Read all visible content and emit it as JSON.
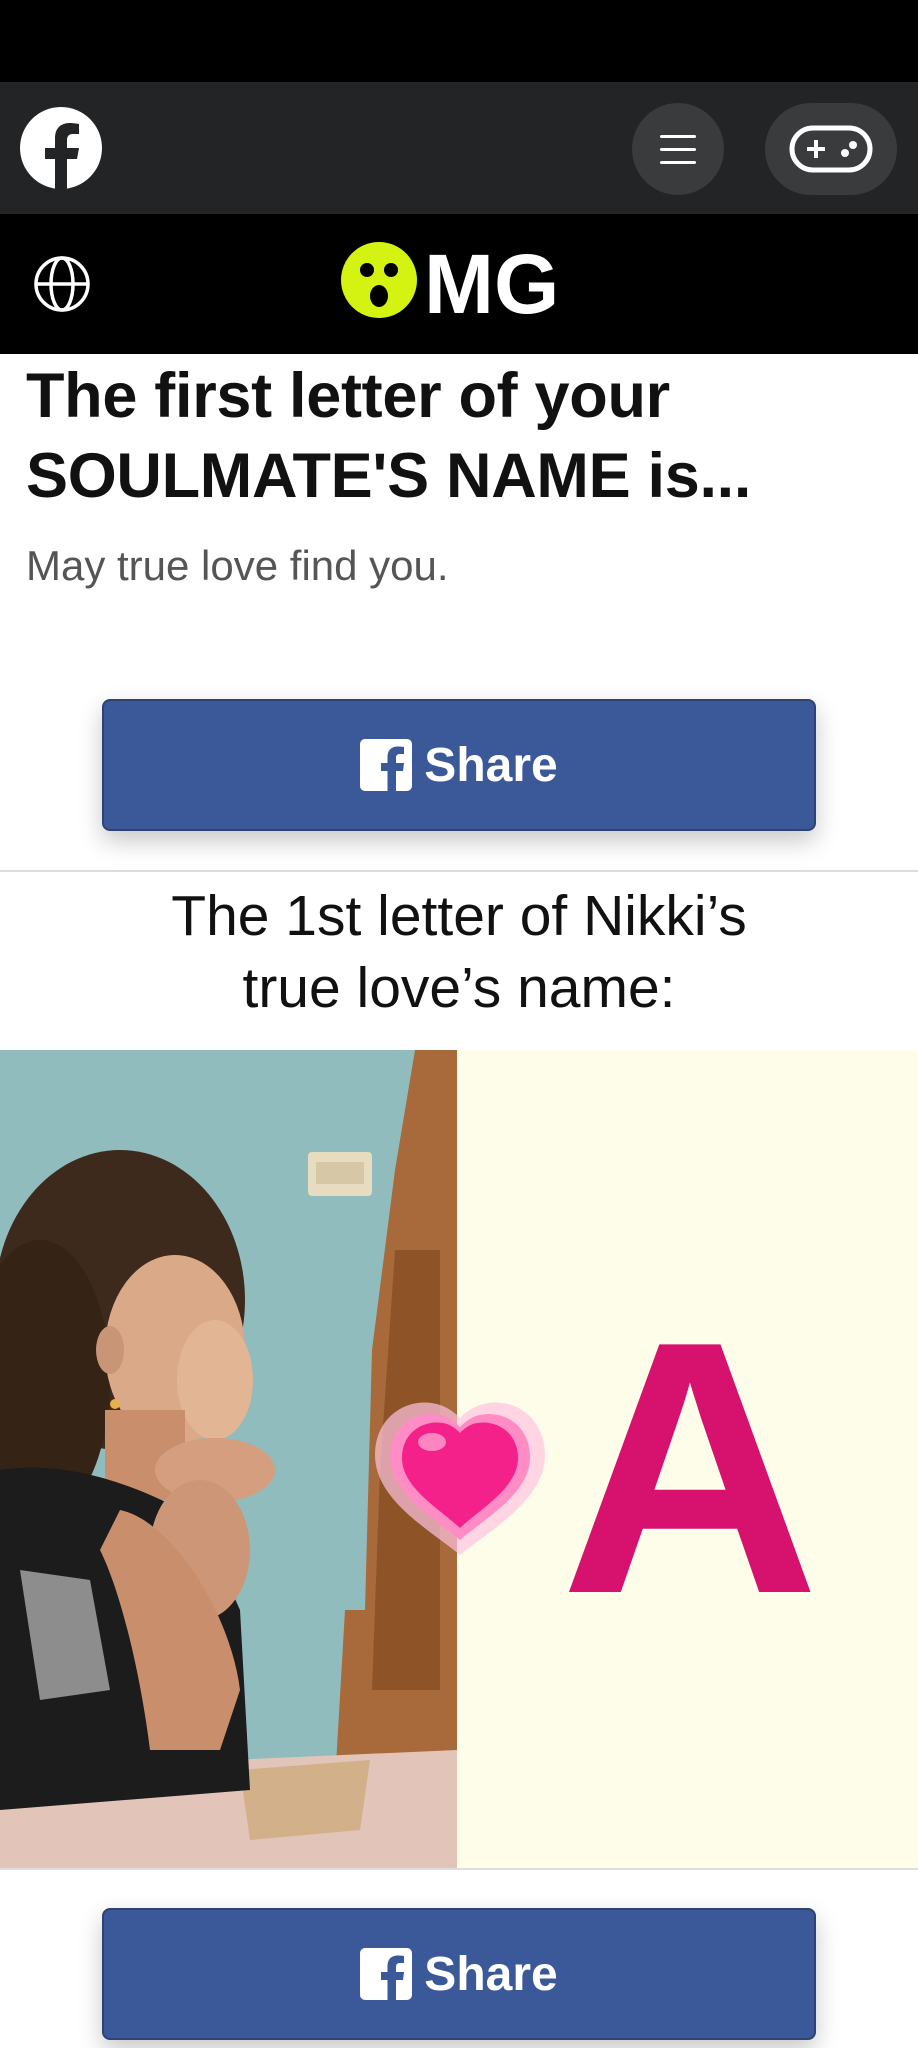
{
  "fb_bar": {
    "logo_icon": "facebook-logo-icon",
    "menu_icon": "hamburger-menu-icon",
    "game_icon": "gamepad-icon"
  },
  "header": {
    "globe_icon": "globe-icon",
    "logo_text": "MG"
  },
  "article": {
    "title": "The first letter of your SOULMATE'S NAME is...",
    "subtitle": "May true love find you."
  },
  "share_button": {
    "label": "Share",
    "icon": "facebook-f-icon",
    "color": "#3b5998"
  },
  "result": {
    "caption_line1": "The 1st letter of Nikki’s",
    "caption_line2": "true love’s name:",
    "letter": "A",
    "letter_color": "#d6126e",
    "heart_icon": "heart-icon"
  },
  "colors": {
    "brand_yellow": "#d4f312",
    "facebook_blue": "#3b5998"
  }
}
